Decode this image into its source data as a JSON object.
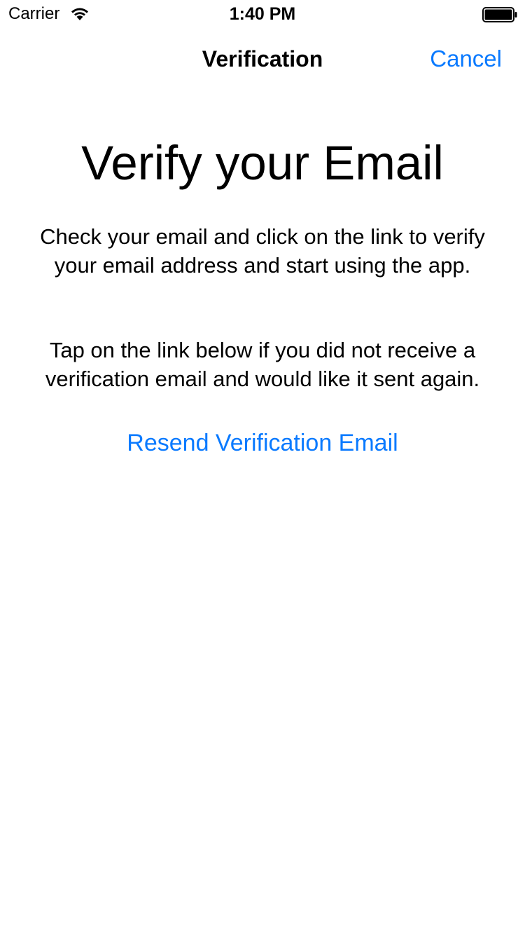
{
  "status_bar": {
    "carrier": "Carrier",
    "time": "1:40 PM",
    "wifi_icon": "wifi-icon",
    "battery_icon": "battery-full-icon"
  },
  "nav": {
    "title": "Verification",
    "cancel_label": "Cancel"
  },
  "main": {
    "heading": "Verify your Email",
    "paragraph_1": "Check your email and click on the link to verify your email address and start using the app.",
    "paragraph_2": "Tap on the link below if you did not receive a verification email and would like it sent again.",
    "resend_label": "Resend Verification Email"
  },
  "colors": {
    "accent": "#0a7aff",
    "text": "#000000",
    "background": "#ffffff"
  }
}
